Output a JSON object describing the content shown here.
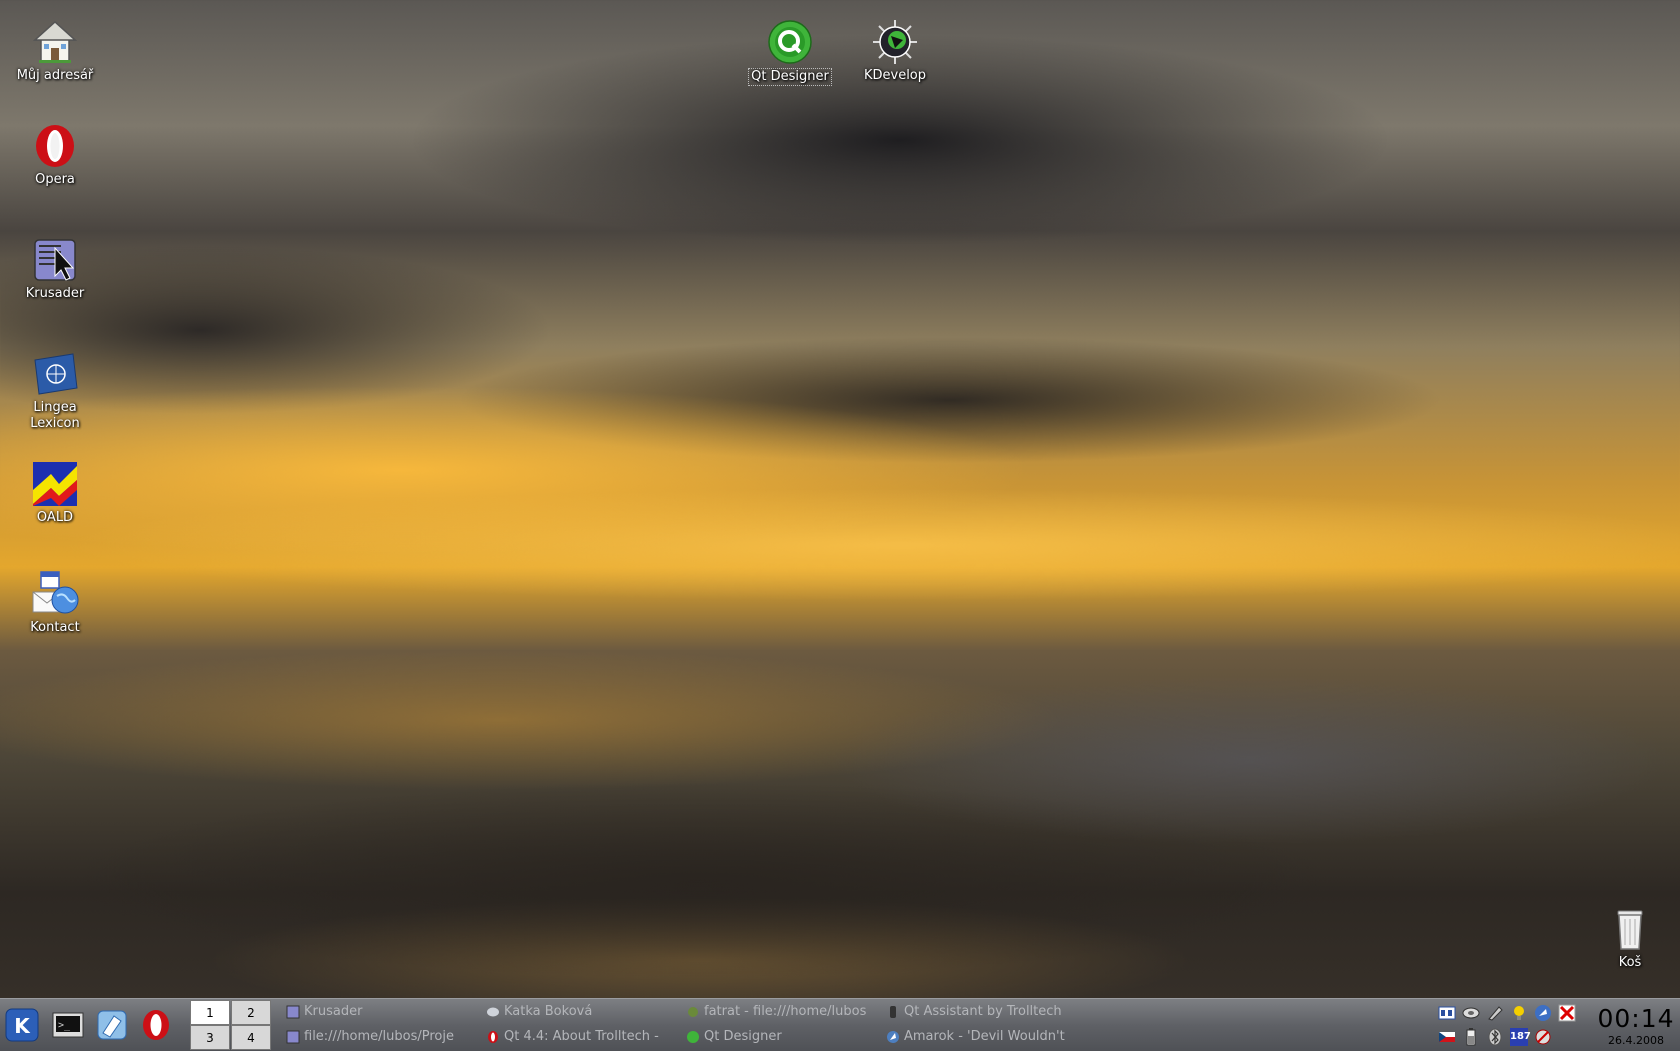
{
  "desktop": {
    "icons": [
      {
        "name": "home-folder",
        "label": "Můj adresář",
        "icon": "house-icon"
      },
      {
        "name": "opera",
        "label": "Opera",
        "icon": "opera-icon"
      },
      {
        "name": "krusader",
        "label": "Krusader",
        "icon": "krusader-icon"
      },
      {
        "name": "lingea-lexicon",
        "label": "Lingea\nLexicon",
        "icon": "globe-flag-icon"
      },
      {
        "name": "oald",
        "label": "OALD",
        "icon": "oald-icon"
      },
      {
        "name": "kontact",
        "label": "Kontact",
        "icon": "kontact-icon"
      },
      {
        "name": "qt-designer",
        "label": "Qt Designer",
        "icon": "qt-icon"
      },
      {
        "name": "kdevelop",
        "label": "KDevelop",
        "icon": "kdevelop-icon"
      },
      {
        "name": "trash",
        "label": "Koš",
        "icon": "trash-icon"
      }
    ]
  },
  "taskbar": {
    "pager": [
      "1",
      "2",
      "3",
      "4"
    ],
    "tasks": [
      {
        "title": "Krusader",
        "icon": "krusader-icon"
      },
      {
        "title": "Katka Boková",
        "icon": "chat-icon"
      },
      {
        "title": "fatrat - file:///home/lubos",
        "icon": "fatrat-icon"
      },
      {
        "title": "Qt Assistant by Trolltech",
        "icon": "qt-assistant-icon"
      },
      {
        "title": "file:///home/lubos/Proje",
        "icon": "krusader-icon"
      },
      {
        "title": "Qt 4.4: About Trolltech -",
        "icon": "opera-icon"
      },
      {
        "title": "Qt Designer",
        "icon": "qt-icon"
      },
      {
        "title": "Amarok - 'Devil Wouldn't",
        "icon": "amarok-icon"
      }
    ],
    "tray_badge": "187",
    "clock": {
      "time": "00:14",
      "date": "26.4.2008"
    }
  },
  "colors": {
    "taskbar_bg": "#5f6166",
    "task_text": "#b4b6ba",
    "pager_active": "#ffffff",
    "accent_qt": "#3fb43a",
    "opera_red": "#cc0f16"
  }
}
